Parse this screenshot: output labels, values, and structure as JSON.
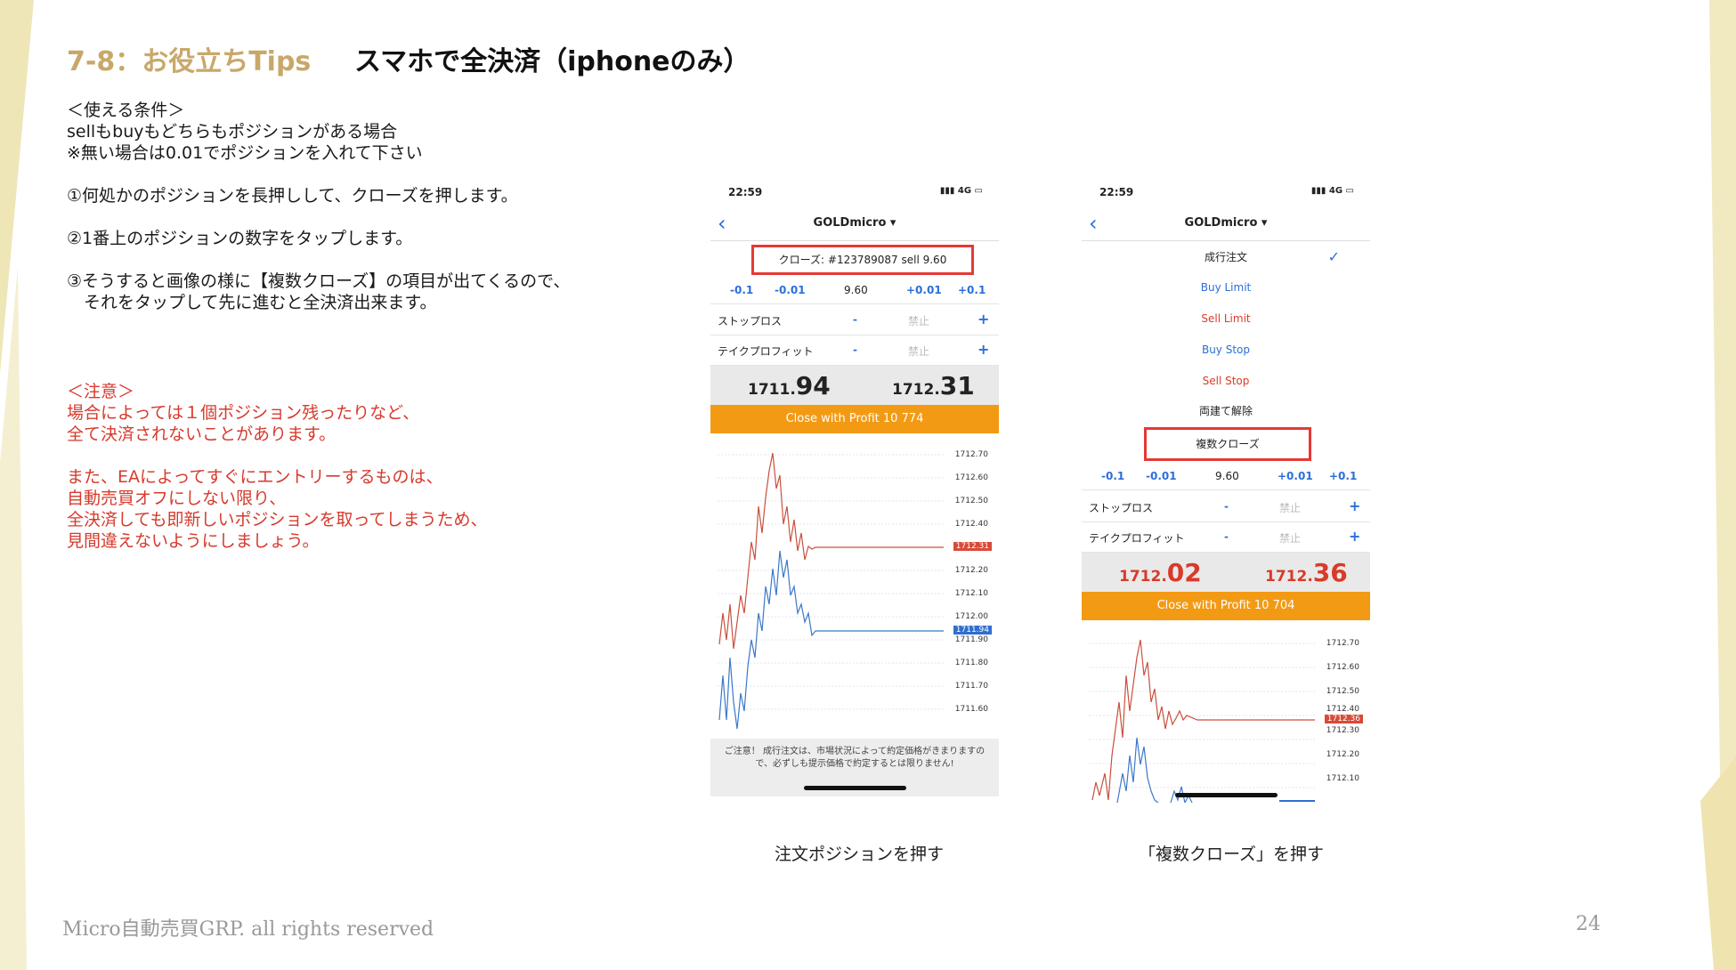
{
  "header": {
    "section": "7-8：お役立ちTips",
    "title": "スマホで全決済（iphoneのみ）"
  },
  "body": {
    "lines": [
      "＜使える条件＞",
      "sellもbuyもどちらもポジションがある場合",
      "※無い場合は0.01でポジションを入れて下さい",
      "",
      "①何処かのポジションを長押しして、クローズを押します。",
      "",
      "②1番上のポジションの数字をタップします。",
      "",
      "③そうすると画像の様に【複数クローズ】の項目が出てくるので、",
      "　それをタップして先に進むと全決済出来ます。"
    ],
    "notes": [
      "＜注意＞",
      "場合によっては１個ポジション残ったりなど、",
      "全て決済されないことがあります。",
      "",
      "また、EAによってすぐにエントリーするものは、",
      "自動売買オフにしない限り、",
      "全決済しても即新しいポジションを取ってしまうため、",
      "見間違えないようにしましょう。"
    ]
  },
  "phone1": {
    "time": "22:59",
    "signal": "4G",
    "symbol": "GOLDmicro ▾",
    "close_line": "クローズ: #123789087 sell 9.60",
    "steps": [
      "-0.1",
      "-0.01",
      "9.60",
      "+0.01",
      "+0.1"
    ],
    "stop_loss": "ストップロス",
    "take_profit": "テイクプロフィット",
    "minus": "-",
    "plus": "+",
    "disabled": "禁止",
    "bid_int": "1711.",
    "bid_dec": "94",
    "ask_int": "1712.",
    "ask_dec": "31",
    "profit_button": "Close with Profit 10 774",
    "y_ticks": [
      "1712.70",
      "1712.60",
      "1712.50",
      "1712.40",
      "1712.20",
      "1712.10",
      "1712.00",
      "1711.90",
      "1711.80",
      "1711.70",
      "1711.60"
    ],
    "ask_tag": "1712.31",
    "bid_tag": "1711.94",
    "notice": "ご注意！ 成行注文は、市場状況によって約定価格がきまりますので、必ずしも提示価格で約定するとは限りません!"
  },
  "phone2": {
    "time": "22:59",
    "signal": "4G",
    "symbol": "GOLDmicro ▾",
    "menu": [
      "成行注文",
      "Buy Limit",
      "Sell Limit",
      "Buy Stop",
      "Sell Stop",
      "両建て解除",
      "複数クローズ"
    ],
    "check": "✓",
    "steps": [
      "-0.1",
      "-0.01",
      "9.60",
      "+0.01",
      "+0.1"
    ],
    "stop_loss": "ストップロス",
    "take_profit": "テイクプロフィット",
    "minus": "-",
    "plus": "+",
    "disabled": "禁止",
    "bid_int": "1712.",
    "bid_dec": "02",
    "ask_int": "1712.",
    "ask_dec": "36",
    "profit_button": "Close with Profit 10 704",
    "y_ticks": [
      "1712.70",
      "1712.60",
      "1712.50",
      "1712.40",
      "1712.30",
      "1712.20",
      "1712.10"
    ],
    "ask_tag": "1712.36"
  },
  "captions": {
    "left": "注文ポジションを押す",
    "right": "「複数クローズ」を押す"
  },
  "footer": {
    "copyright": "Micro自動売買GRP. all rights reserved",
    "page": "24"
  },
  "colors": {
    "accent_gold": "#c8a86a",
    "note_red": "#d63a2c",
    "profit_orange": "#f39a14",
    "ios_blue": "#2b6fd8"
  }
}
